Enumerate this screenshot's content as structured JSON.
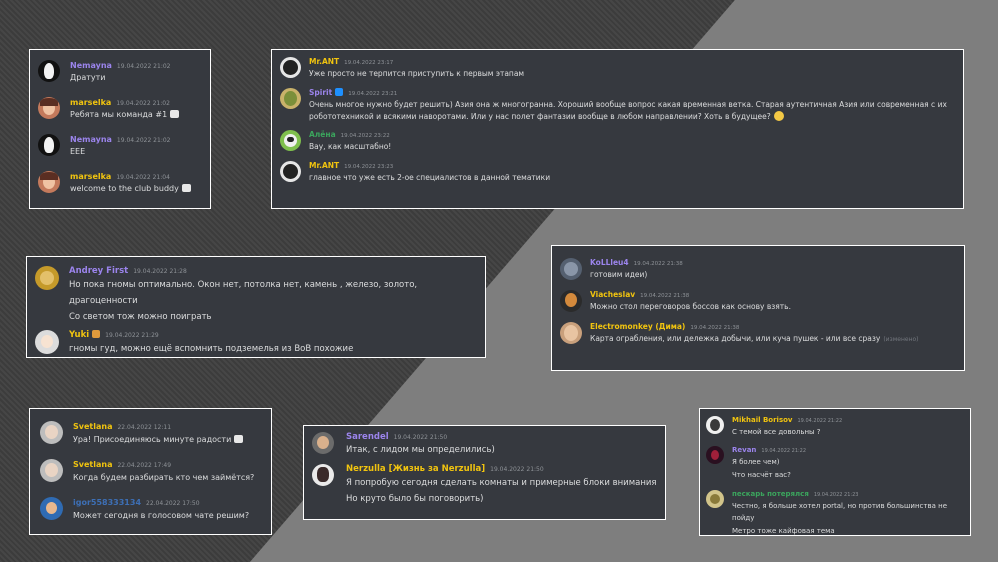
{
  "colors": {
    "purple": "#9b84ec",
    "yellow": "#f1c40f",
    "green": "#3ba55d",
    "blue": "#3d6fb5",
    "text": "#dcddde",
    "muted": "#8e9297",
    "panel": "#36393f"
  },
  "panels": [
    {
      "messages": [
        {
          "name": "Nemayna",
          "time": "19.04.2022 21:02",
          "lines": [
            "Дратути"
          ]
        },
        {
          "name": "marselka",
          "time": "19.04.2022 21:02",
          "lines": [
            "Ребята мы команда #1"
          ]
        },
        {
          "name": "Nemayna",
          "time": "19.04.2022 21:02",
          "lines": [
            "EEE"
          ]
        },
        {
          "name": "marselka",
          "time": "19.04.2022 21:04",
          "lines": [
            "welcome to the club buddy"
          ]
        }
      ]
    },
    {
      "messages": [
        {
          "name": "Mr.ANT",
          "time": "19.04.2022 23:17",
          "lines": [
            "Уже просто не терпится приступить к первым этапам"
          ]
        },
        {
          "name": "Spirit",
          "time": "19.04.2022 23:21",
          "lines": [
            "Очень многое нужно будет решить) Азия она ж многогранна. Хороший вообще вопрос какая временная ветка. Старая аутентичная Азия или современная с их",
            "робототехникой и всякими наворотами. Или у нас полет фантазии вообще в любом направлении? Хоть в будущее?"
          ]
        },
        {
          "name": "Алёна",
          "time": "19.04.2022 23:22",
          "lines": [
            "Вау, как масштабно!"
          ]
        },
        {
          "name": "Mr.ANT",
          "time": "19.04.2022 23:23",
          "lines": [
            "главное что уже есть 2-ое специалистов в данной тематики"
          ]
        }
      ]
    },
    {
      "messages": [
        {
          "name": "Andrey First",
          "time": "19.04.2022 21:28",
          "lines": [
            "Но пока гномы оптимально. Окон нет, потолка нет, камень , железо, золото, драгоценности",
            "Со светом тож можно поиграть"
          ]
        },
        {
          "name": "Yuki",
          "time": "19.04.2022 21:29",
          "lines": [
            "гномы гуд, можно ещё вспомнить подземелья из BoB похожие"
          ]
        }
      ]
    },
    {
      "messages": [
        {
          "name": "KoLLleu4",
          "time": "19.04.2022 21:38",
          "lines": [
            "готовим идеи)"
          ]
        },
        {
          "name": "Viacheslav",
          "time": "19.04.2022 21:38",
          "lines": [
            "Можно стол переговоров боссов как основу взять."
          ]
        },
        {
          "name": "Electromonkey (Дима)",
          "time": "19.04.2022 21:38",
          "lines": [
            "Карта ограбления, или дележка добычи, или куча пушек - или все сразу"
          ],
          "edited": "(изменено)"
        }
      ]
    },
    {
      "messages": [
        {
          "name": "Svetlana",
          "time": "22.04.2022 12:11",
          "lines": [
            "Ура! Присоединяюсь минуте радости"
          ]
        },
        {
          "name": "Svetlana",
          "time": "22.04.2022 17:49",
          "lines": [
            "Когда будем разбирать кто чем займётся?"
          ]
        },
        {
          "name": "igor558333134",
          "time": "22.04.2022 17:50",
          "lines": [
            "Может сегодня в голосовом чате решим?"
          ]
        }
      ]
    },
    {
      "messages": [
        {
          "name": "Sarendel",
          "time": "19.04.2022 21:50",
          "lines": [
            "Итак, с лидом мы определились)"
          ]
        },
        {
          "name": "Nerzulla [Жизнь за Nerzulla]",
          "time": "19.04.2022 21:50",
          "lines": [
            "Я попробую сегодня сделать комнаты и примерные блоки внимания",
            "Но круто было бы поговорить)"
          ]
        }
      ]
    },
    {
      "messages": [
        {
          "name": "Mikhail Borisov",
          "time": "19.04.2022 21:22",
          "lines": [
            "С темой все довольны ?"
          ]
        },
        {
          "name": "Revan",
          "time": "19.04.2022 21:22",
          "lines": [
            "Я более чем)",
            "Что насчёт вас?"
          ]
        },
        {
          "name": "пескарь потерялся",
          "time": "19.04.2022 21:23",
          "lines": [
            "Честно, я больше хотел portal, но против большинства не пойду",
            "Метро тоже кайфовая тема"
          ]
        }
      ]
    }
  ]
}
